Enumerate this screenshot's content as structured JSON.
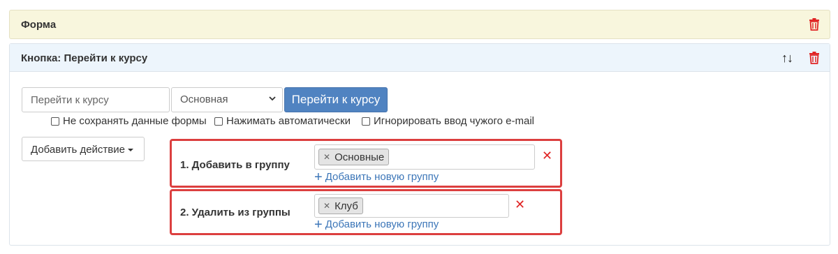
{
  "form_panel": {
    "title": "Форма",
    "delete_icon": "trash-icon"
  },
  "button_panel": {
    "title": "Кнопка: Перейти к курсу",
    "move_arrows": "↑↓",
    "delete_icon": "trash-icon"
  },
  "button_settings": {
    "text_value": "Перейти к курсу",
    "style_select": "Основная",
    "preview_label": "Перейти к курсу"
  },
  "options": [
    {
      "label": "Не сохранять данные формы",
      "checked": false
    },
    {
      "label": "Нажимать автоматически",
      "checked": false
    },
    {
      "label": "Игнорировать ввод чужого e-mail",
      "checked": false
    }
  ],
  "add_action_label": "Добавить действие",
  "actions": [
    {
      "label": "1. Добавить в группу",
      "tag": "Основные",
      "add_group_link": "Добавить новую группу"
    },
    {
      "label": "2. Удалить из группы",
      "tag": "Клуб",
      "add_group_link": "Добавить новую группу"
    }
  ],
  "colors": {
    "form_panel_bg": "#f8f6dd",
    "button_panel_header_bg": "#edf5fc",
    "primary": "#5083c1",
    "danger": "#dc3f3f",
    "link": "#3c76b8"
  }
}
